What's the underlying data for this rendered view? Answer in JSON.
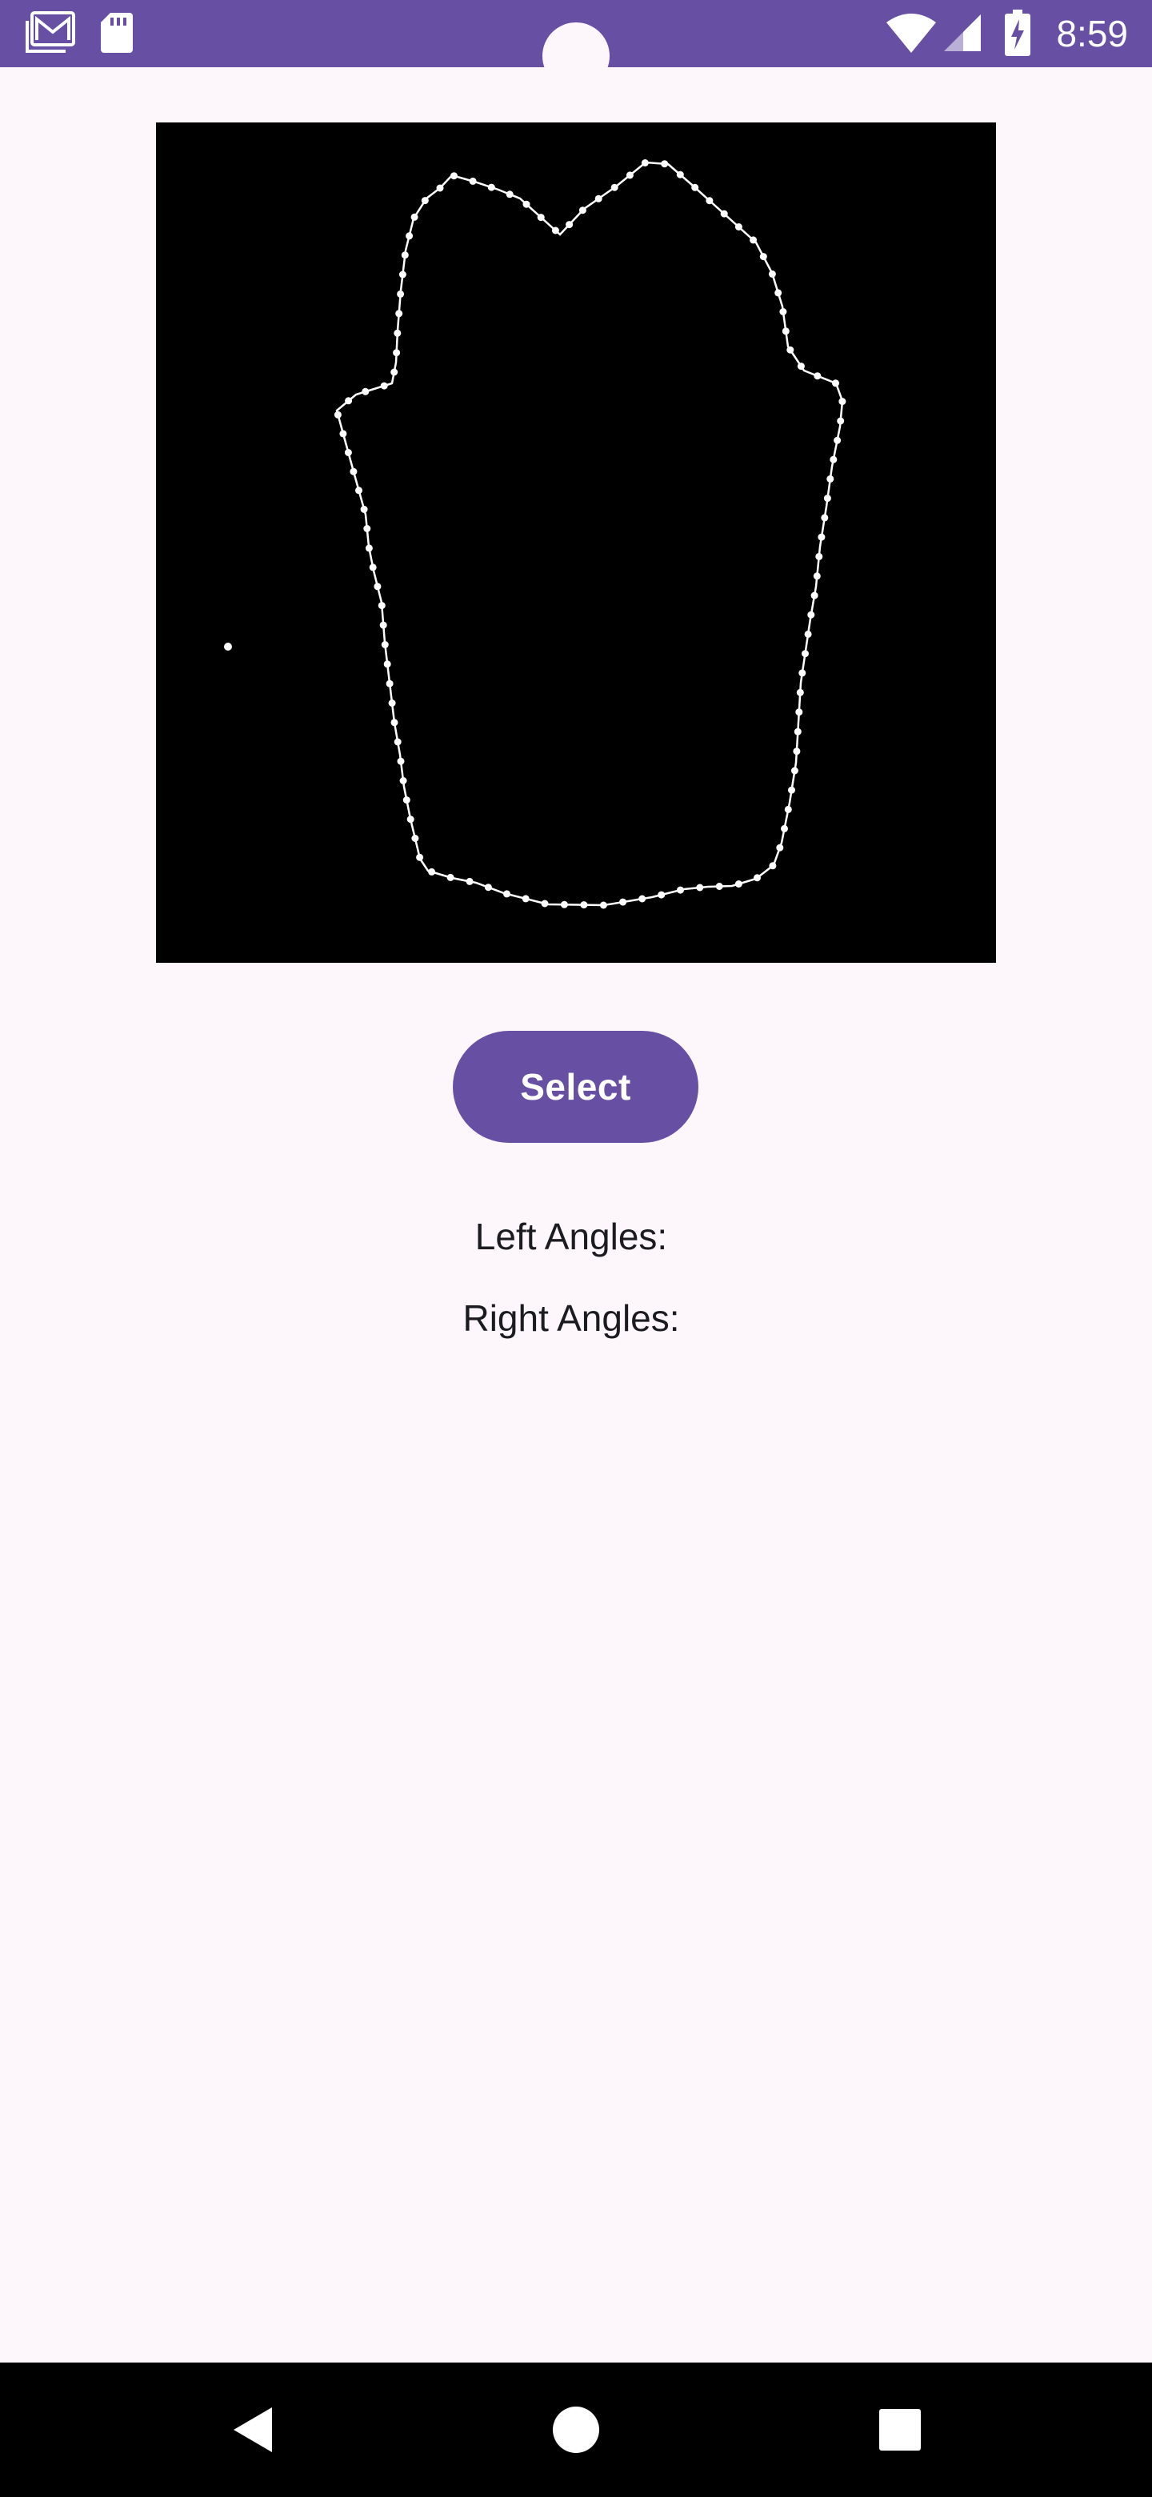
{
  "status_bar": {
    "time": "8:59",
    "left_icons": [
      "gmail-icon",
      "sd-card-icon"
    ],
    "right_icons": [
      "wifi-icon",
      "signal-icon",
      "battery-charging-icon"
    ],
    "background_color": "#6750a4"
  },
  "preview": {
    "background_color": "#000000",
    "outline_color": "#ffffff"
  },
  "select_button": {
    "label": "Select",
    "color": "#6750a4"
  },
  "results": {
    "left_angles_label": "Left Angles:",
    "right_angles_label": "Right Angles:"
  },
  "nav_bar": {
    "items": [
      "back-icon",
      "home-icon",
      "recents-icon"
    ]
  }
}
